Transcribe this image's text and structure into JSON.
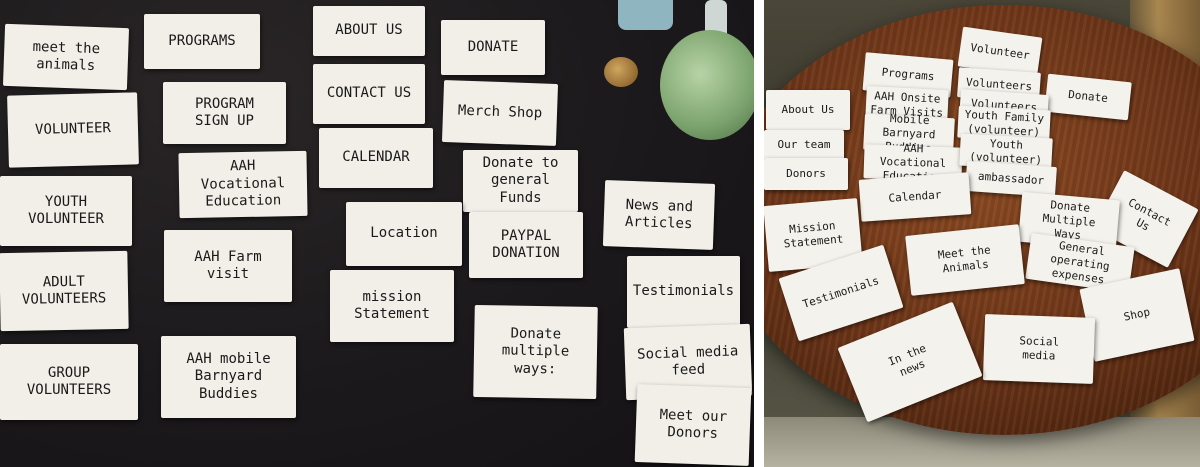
{
  "left_photo": {
    "cards": [
      {
        "id": "meet-the-animals",
        "text": "meet the\nanimals"
      },
      {
        "id": "programs",
        "text": "PROGRAMS"
      },
      {
        "id": "about-us",
        "text": "ABOUT US"
      },
      {
        "id": "donate",
        "text": "DONATE"
      },
      {
        "id": "volunteer",
        "text": "VOLUNTEER"
      },
      {
        "id": "program-sign-up",
        "text": "PROGRAM\nSIGN UP"
      },
      {
        "id": "contact-us",
        "text": "CONTACT US"
      },
      {
        "id": "merch-shop",
        "text": "Merch Shop"
      },
      {
        "id": "aah-vocational-education",
        "text": "AAH\nVocational\nEducation"
      },
      {
        "id": "calendar",
        "text": "CALENDAR"
      },
      {
        "id": "donate-general-funds",
        "text": "Donate to\ngeneral Funds"
      },
      {
        "id": "youth-volunteer",
        "text": "YOUTH VOLUNTEER"
      },
      {
        "id": "news-and-articles",
        "text": "News and Articles"
      },
      {
        "id": "location",
        "text": "Location"
      },
      {
        "id": "paypal-donation",
        "text": "PAYPAL\nDONATION"
      },
      {
        "id": "aah-farm-visit",
        "text": "AAH Farm\nvisit"
      },
      {
        "id": "adult-volunteers",
        "text": "ADULT VOLUNTEERS"
      },
      {
        "id": "testimonials",
        "text": "Testimonials"
      },
      {
        "id": "mission-statement",
        "text": "mission\nStatement"
      },
      {
        "id": "donate-multiple-ways",
        "text": "Donate multiple\nways:"
      },
      {
        "id": "social-media-feed",
        "text": "Social media\nfeed"
      },
      {
        "id": "aah-mobile-barnyard-buddies",
        "text": "AAH mobile\nBarnyard Buddies"
      },
      {
        "id": "group-volunteers",
        "text": "GROUP VOLUNTEERS"
      },
      {
        "id": "meet-our-donors",
        "text": "Meet our\nDonors"
      }
    ]
  },
  "right_photo": {
    "cards": [
      {
        "id": "volunteer",
        "text": "Volunteer"
      },
      {
        "id": "programs",
        "text": "Programs"
      },
      {
        "id": "volunteers",
        "text": "Volunteers"
      },
      {
        "id": "donate",
        "text": "Donate"
      },
      {
        "id": "about-us",
        "text": "About Us"
      },
      {
        "id": "aah-farm-visits",
        "text": "AAH Onsite\nFarm Visits"
      },
      {
        "id": "volunteers-2",
        "text": "Volunteers"
      },
      {
        "id": "mobile-barnyard-buddies",
        "text": "Mobile Barnyard\nBuddies"
      },
      {
        "id": "youth-family",
        "text": "Youth Family\n(volunteer)"
      },
      {
        "id": "our-team",
        "text": "Our team"
      },
      {
        "id": "vocational-education",
        "text": "AAH\nVocational\nEducation"
      },
      {
        "id": "youth-volunteer",
        "text": "Youth\n(volunteer)"
      },
      {
        "id": "donors",
        "text": "Donors"
      },
      {
        "id": "ambassador",
        "text": "ambassador"
      },
      {
        "id": "calendar",
        "text": "Calendar"
      },
      {
        "id": "contact-us",
        "text": "Contact\nUs"
      },
      {
        "id": "donate-multiple-ways",
        "text": "Donate\nMultiple\nWays"
      },
      {
        "id": "mission-statement",
        "text": "Mission\nStatement"
      },
      {
        "id": "general-operating-expenses",
        "text": "General\noperating\nexpenses"
      },
      {
        "id": "meet-the-animals",
        "text": "Meet the\nAnimals"
      },
      {
        "id": "testimonials",
        "text": "Testimonials"
      },
      {
        "id": "shop",
        "text": "Shop"
      },
      {
        "id": "social-media",
        "text": "Social\nmedia"
      },
      {
        "id": "in-the-news",
        "text": "In the\nnews"
      }
    ]
  }
}
